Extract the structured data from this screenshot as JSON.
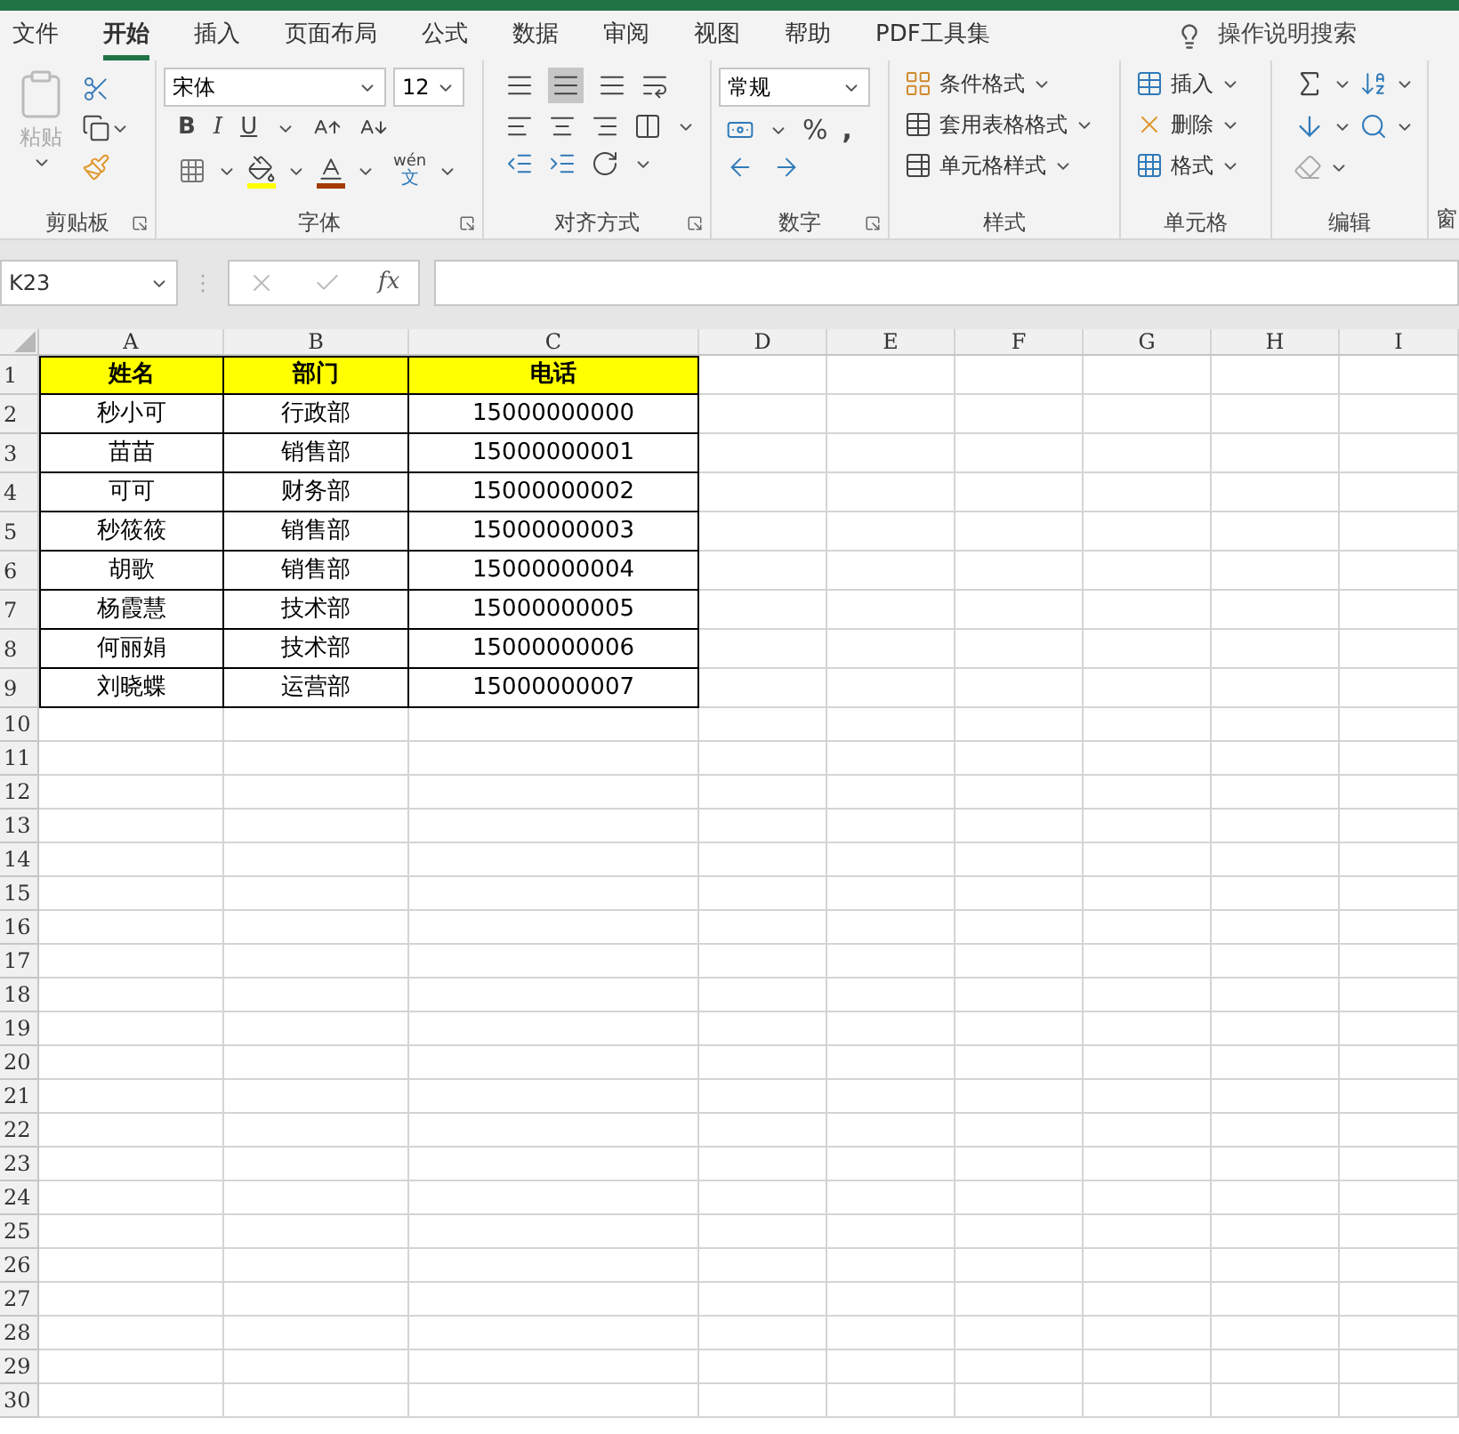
{
  "tabs": [
    {
      "label": "文件",
      "selected": false
    },
    {
      "label": "开始",
      "selected": true
    },
    {
      "label": "插入",
      "selected": false
    },
    {
      "label": "页面布局",
      "selected": false
    },
    {
      "label": "公式",
      "selected": false
    },
    {
      "label": "数据",
      "selected": false
    },
    {
      "label": "审阅",
      "selected": false
    },
    {
      "label": "视图",
      "selected": false
    },
    {
      "label": "帮助",
      "selected": false
    },
    {
      "label": "PDF工具集",
      "selected": false
    }
  ],
  "tell_me": "操作说明搜索",
  "ribbon": {
    "paste": {
      "label": "粘贴",
      "disabled": true
    },
    "font_name": "宋体",
    "font_size": "12",
    "font_styles": [
      "B",
      "I",
      "U"
    ],
    "phonetic": {
      "top": "wén",
      "bottom": "文"
    },
    "number_format": "常规",
    "percent": "%",
    "comma": ",",
    "styles": [
      "条件格式",
      "套用表格格式",
      "单元格样式"
    ],
    "cells": [
      "插入",
      "删除",
      "格式"
    ],
    "groups": [
      "剪贴板",
      "字体",
      "对齐方式",
      "数字",
      "样式",
      "单元格",
      "编辑",
      "窗"
    ]
  },
  "name_box": "K23",
  "grip": "⋮",
  "fx": "fx",
  "columns": [
    "A",
    "B",
    "C",
    "D",
    "E",
    "F",
    "G",
    "H",
    "I"
  ],
  "rows": [
    {
      "number": "1",
      "kind": "header",
      "cells": [
        "姓名",
        "部门",
        "电话"
      ]
    },
    {
      "number": "2",
      "kind": "data",
      "cells": [
        "秒小可",
        "行政部",
        "15000000000"
      ]
    },
    {
      "number": "3",
      "kind": "data",
      "cells": [
        "苗苗",
        "销售部",
        "15000000001"
      ]
    },
    {
      "number": "4",
      "kind": "data",
      "cells": [
        "可可",
        "财务部",
        "15000000002"
      ]
    },
    {
      "number": "5",
      "kind": "data",
      "cells": [
        "秒筱筱",
        "销售部",
        "15000000003"
      ]
    },
    {
      "number": "6",
      "kind": "data",
      "cells": [
        "胡歌",
        "销售部",
        "15000000004"
      ]
    },
    {
      "number": "7",
      "kind": "data",
      "cells": [
        "杨霞慧",
        "技术部",
        "15000000005"
      ]
    },
    {
      "number": "8",
      "kind": "data",
      "cells": [
        "何丽娟",
        "技术部",
        "15000000006"
      ]
    },
    {
      "number": "9",
      "kind": "data",
      "cells": [
        "刘晓蝶",
        "运营部",
        "15000000007"
      ]
    },
    {
      "number": "10"
    },
    {
      "number": "11"
    },
    {
      "number": "12"
    },
    {
      "number": "13"
    },
    {
      "number": "14"
    },
    {
      "number": "15"
    },
    {
      "number": "16"
    },
    {
      "number": "17"
    },
    {
      "number": "18"
    },
    {
      "number": "19"
    },
    {
      "number": "20"
    },
    {
      "number": "21"
    },
    {
      "number": "22"
    },
    {
      "number": "23"
    },
    {
      "number": "24"
    },
    {
      "number": "25"
    },
    {
      "number": "26"
    },
    {
      "number": "27"
    },
    {
      "number": "28"
    },
    {
      "number": "29"
    },
    {
      "number": "30"
    }
  ]
}
